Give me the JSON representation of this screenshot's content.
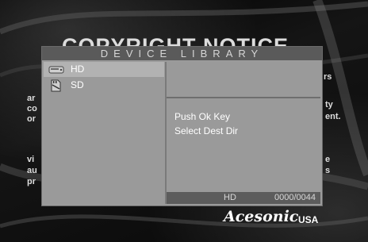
{
  "background": {
    "heading": "COPYRIGHT NOTICE",
    "fragments_left": [
      "ar",
      "co",
      "or",
      "vi",
      "au",
      "pr"
    ],
    "fragments_right": [
      "rs",
      "ty",
      "ent.",
      "e",
      "s"
    ]
  },
  "panel": {
    "title": "DEVICE LIBRARY",
    "devices": [
      {
        "label": "HD",
        "icon": "hard-drive-icon"
      },
      {
        "label": "SD",
        "icon": "sd-card-icon"
      }
    ],
    "message_line1": "Push Ok Key",
    "message_line2": "Select Dest Dir",
    "status_device": "HD",
    "status_count": "0000/0044"
  },
  "brand": {
    "name": "Acesonic",
    "suffix": "USA"
  }
}
